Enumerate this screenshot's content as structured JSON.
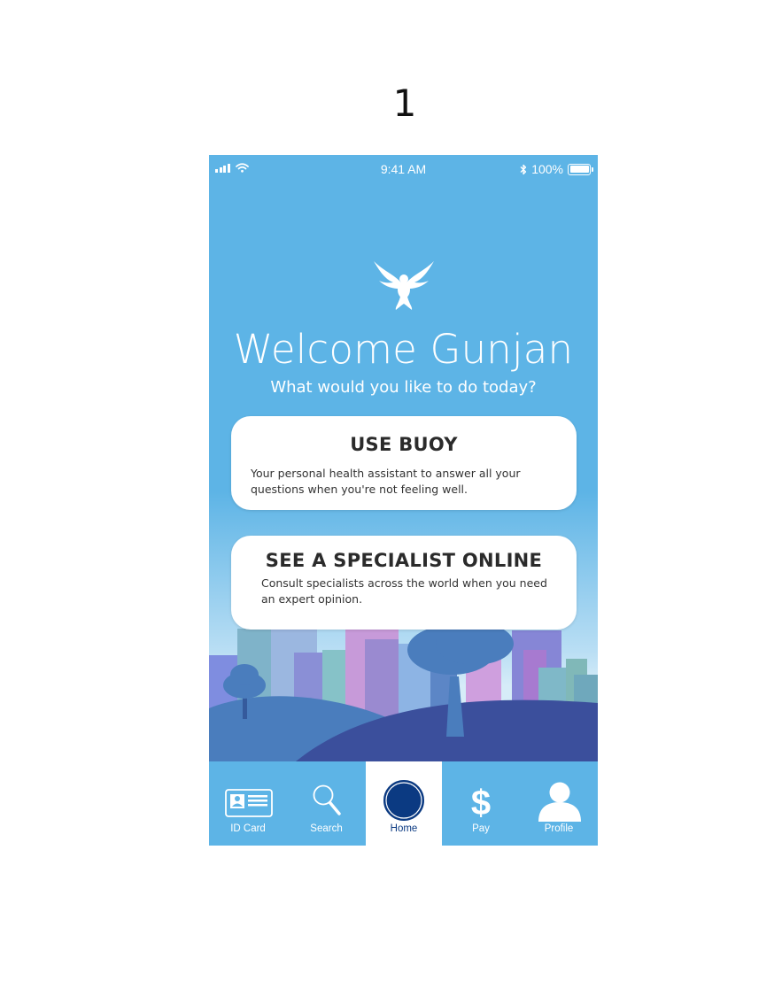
{
  "page_number": "1",
  "status_bar": {
    "time": "9:41 AM",
    "battery": "100%",
    "signal_icon": "signal-bars-icon",
    "wifi_icon": "wifi-icon",
    "bluetooth_icon": "bluetooth-icon",
    "battery_icon": "battery-icon"
  },
  "header": {
    "logo_icon": "bird-logo-icon",
    "welcome": "Welcome Gunjan",
    "subtitle": "What would you like to do today?"
  },
  "cards": [
    {
      "title": "USE BUOY",
      "description": "Your personal health assistant to answer all your questions when you're not feeling well."
    },
    {
      "title": "SEE A SPECIALIST ONLINE",
      "description": "Consult specialists across the world when you need an expert opinion."
    }
  ],
  "tab_bar": {
    "active": "Home",
    "tabs": [
      {
        "label": "ID Card",
        "icon": "id-card-icon"
      },
      {
        "label": "Search",
        "icon": "search-icon"
      },
      {
        "label": "Home",
        "icon": "home-circle-icon"
      },
      {
        "label": "Pay",
        "icon": "dollar-icon"
      },
      {
        "label": "Profile",
        "icon": "profile-icon"
      }
    ]
  },
  "colors": {
    "primary_blue": "#5db4e6",
    "active_tab_text": "#0b3a82",
    "home_circle": "#0b3a82",
    "hill_dark": "#3b4f9c",
    "hill_light": "#4a7dbd"
  }
}
